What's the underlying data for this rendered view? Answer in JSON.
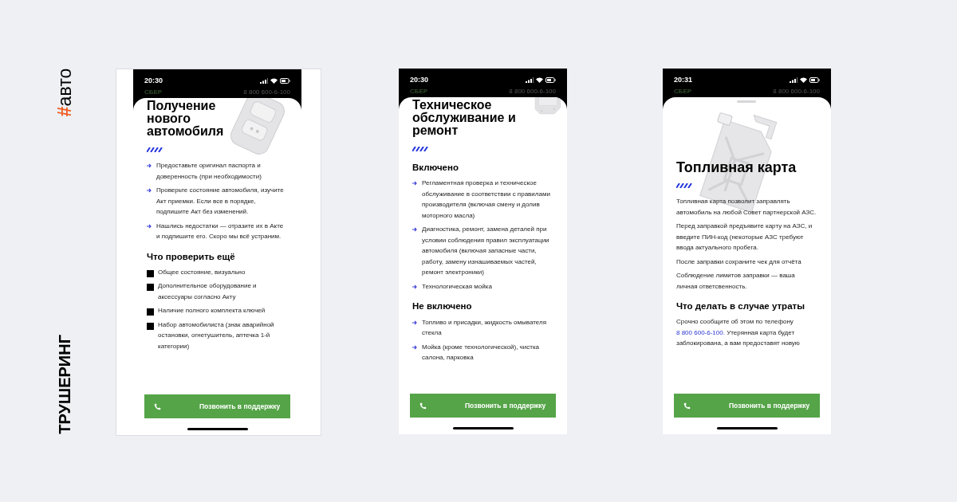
{
  "side_label": {
    "hash": "#",
    "word": "авто",
    "brand": "ТРУШЕРИНГ"
  },
  "phones": [
    {
      "framed": true,
      "time": "20:30",
      "header": {
        "brand": "СБЕР",
        "phone": "8 800 600-6-100"
      },
      "grabber": false,
      "illustration": {
        "kind": "fob"
      },
      "title": "Получение нового автомобиля",
      "sections": [
        {
          "items": [
            {
              "kind": "arrow",
              "text": "Предоставьте оригинал паспорта и доверенность (при необходимости)"
            },
            {
              "kind": "arrow",
              "text": "Проверьте состояние автомобиля, изучите Акт приемки. Если все в порядке, подпишите Акт без изменений."
            },
            {
              "kind": "arrow",
              "text": "Нашлись недостатки — отразите их в Акте и подпишите его. Скоро мы всё устраним."
            }
          ]
        },
        {
          "heading": "Что проверить ещё",
          "items": [
            {
              "kind": "square",
              "text": "Общее состояние, визуально"
            },
            {
              "kind": "square",
              "text": "Дополнительное оборудование и аксессуары согласно Акту"
            },
            {
              "kind": "square",
              "text": "Наличие полного комплекта ключей"
            },
            {
              "kind": "square",
              "text": "Набор автомобилиста (знак аварийной остановки, огнетушитель, аптечка 1-й категории)"
            }
          ]
        }
      ],
      "button": "Позвонить в поддержку"
    },
    {
      "framed": false,
      "time": "20:30",
      "header": {
        "brand": "СБЕР",
        "phone": "8 800 600-6-100"
      },
      "grabber": false,
      "illustration": {
        "kind": "device"
      },
      "title": "Техническое обслуживание и ремонт",
      "sections": [
        {
          "heading": "Включено",
          "items": [
            {
              "kind": "arrow",
              "text": "Регламентная проверка и техническое обслуживание в соответствии с правилами производителя (включая смену и долив моторного масла)"
            },
            {
              "kind": "arrow",
              "text": "Диагностика, ремонт, замена деталей при условии соблюдения правил эксплуатации автомобиля (включая запасные части, работу, замену изнашиваемых частей, ремонт электроники)"
            },
            {
              "kind": "arrow",
              "text": "Технологическая мойка"
            }
          ]
        },
        {
          "heading": "Не включено",
          "items": [
            {
              "kind": "arrow",
              "text": "Топливо и присадки, жидкость омывателя стекла"
            },
            {
              "kind": "arrow",
              "text": "Мойка (кроме технологической), чистка салона, парковка"
            }
          ]
        }
      ],
      "button": "Позвонить в поддержку"
    },
    {
      "framed": false,
      "time": "20:31",
      "header": {
        "brand": "СБЕР",
        "phone": "8 800 600-6-100"
      },
      "grabber": true,
      "illustration": {
        "kind": "canister"
      },
      "title": "Топливная карта",
      "sections": [
        {
          "items": [
            {
              "kind": "paragraph",
              "text": "Топливная карта позволит заправлять автомобиль на любой Совет партнерской АЗС."
            },
            {
              "kind": "paragraph",
              "text": "Перед заправкой предъявите карту на АЗС, и введите ПИН-код (некоторые АЗС требуют ввода актуального пробега."
            },
            {
              "kind": "paragraph",
              "text": "После заправки сохраните чек для отчёта"
            },
            {
              "kind": "paragraph",
              "text": "Соблюдение лимитов заправки — ваша личная ответсвенность."
            }
          ]
        },
        {
          "heading": "Что делать в случае утраты",
          "items": [
            {
              "kind": "paragraph",
              "text": "Срочно сообщите об этом по телефону",
              "link": "8 800 600-6-100.",
              "after": "Утерянная карта будет заблокирована, а вам предоставят новую"
            }
          ]
        }
      ],
      "button": "Позвонить в поддержку"
    }
  ]
}
